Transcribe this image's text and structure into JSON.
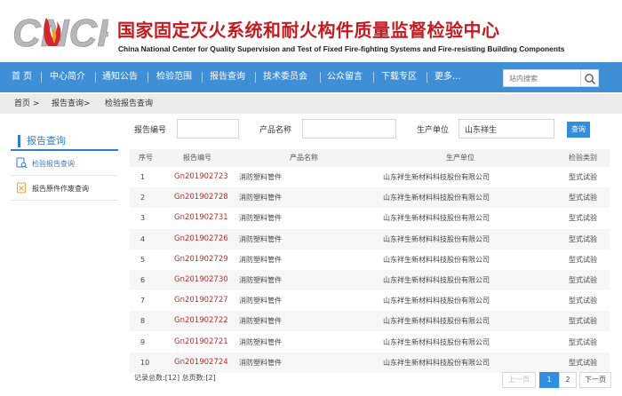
{
  "header": {
    "logo_text": "CNCF",
    "title_cn": "国家固定灭火系统和耐火构件质量监督检验中心",
    "title_en": "China National Center for Quality Supervision and Test of Fixed Fire-fighting Systems and Fire-resisting Building Components"
  },
  "nav": {
    "items": [
      "首 页",
      "中心简介",
      "通知公告",
      "检验范围",
      "报告查询",
      "技术委员会",
      "公众留言",
      "下载专区",
      "更多..."
    ],
    "search_placeholder": "站内搜索"
  },
  "breadcrumb": [
    "首页 >",
    "报告查询>",
    "检验报告查询"
  ],
  "sidebar": {
    "title": "报告查询",
    "items": [
      "检验报告查询",
      "报告原件作废查询"
    ]
  },
  "filters": {
    "report_no_label": "报告编号",
    "report_no_value": "",
    "product_label": "产品名称",
    "product_value": "",
    "maker_label": "生产单位",
    "maker_value": "山东祥生",
    "query_button": "查询"
  },
  "table": {
    "headers": [
      "序号",
      "报告编号",
      "产品名称",
      "生产单位",
      "检验类别"
    ],
    "rows": [
      [
        "1",
        "Gn201902723",
        "消防塑料管件",
        "山东祥生新材料科技股份有限公司",
        "型式试验"
      ],
      [
        "2",
        "Gn201902728",
        "消防塑料管件",
        "山东祥生新材料科技股份有限公司",
        "型式试验"
      ],
      [
        "3",
        "Gn201902731",
        "消防塑料管件",
        "山东祥生新材料科技股份有限公司",
        "型式试验"
      ],
      [
        "4",
        "Gn201902726",
        "消防塑料管件",
        "山东祥生新材料科技股份有限公司",
        "型式试验"
      ],
      [
        "5",
        "Gn201902729",
        "消防塑料管件",
        "山东祥生新材料科技股份有限公司",
        "型式试验"
      ],
      [
        "6",
        "Gn201902730",
        "消防塑料管件",
        "山东祥生新材料科技股份有限公司",
        "型式试验"
      ],
      [
        "7",
        "Gn201902727",
        "消防塑料管件",
        "山东祥生新材料科技股份有限公司",
        "型式试验"
      ],
      [
        "8",
        "Gn201902722",
        "消防塑料管件",
        "山东祥生新材料科技股份有限公司",
        "型式试验"
      ],
      [
        "9",
        "Gn201902721",
        "消防塑料管件",
        "山东祥生新材料科技股份有限公司",
        "型式试验"
      ],
      [
        "10",
        "Gn201902724",
        "消防塑料管件",
        "山东祥生新材料科技股份有限公司",
        "型式试验"
      ]
    ]
  },
  "pagination": {
    "summary": "记录总数:[12] 总页数:[2]",
    "prev": "上一页",
    "pages": [
      "1",
      "2"
    ],
    "next": "下一页"
  },
  "colors": {
    "brand_red": "#c41a20",
    "nav_blue": "#3f8fd7",
    "accent_blue": "#2f8ee0",
    "link_red": "#b5302f"
  }
}
